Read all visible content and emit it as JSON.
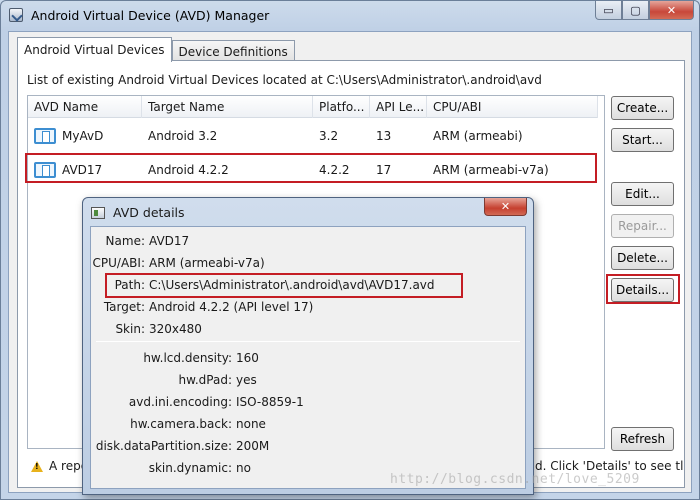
{
  "window": {
    "title": "Android Virtual Device (AVD) Manager",
    "minimize_glyph": "▭",
    "maximize_glyph": "▢",
    "close_glyph": "✕"
  },
  "tabs": [
    {
      "label": "Android Virtual Devices",
      "active": true
    },
    {
      "label": "Device Definitions",
      "active": false
    }
  ],
  "list_label": "List of existing Android Virtual Devices located at C:\\Users\\Administrator\\.android\\avd",
  "table": {
    "columns": [
      "AVD Name",
      "Target Name",
      "Platfo...",
      "API Le...",
      "CPU/ABI"
    ],
    "rows": [
      {
        "avd": "MyAvD",
        "target": "Android 3.2",
        "platform": "3.2",
        "api": "13",
        "cpu": "ARM (armeabi)"
      },
      {
        "avd": "AVD17",
        "target": "Android 4.2.2",
        "platform": "4.2.2",
        "api": "17",
        "cpu": "ARM (armeabi-v7a)"
      }
    ]
  },
  "buttons": {
    "create": "Create...",
    "start": "Start...",
    "edit": "Edit...",
    "repair": "Repair...",
    "delete": "Delete...",
    "details": "Details...",
    "refresh": "Refresh"
  },
  "footer": {
    "left": "A repo",
    "right": "d. Click 'Details' to see tl"
  },
  "dialog": {
    "title": "AVD details",
    "close_glyph": "✕",
    "basic": [
      {
        "key": "Name:",
        "value": "AVD17"
      },
      {
        "key": "CPU/ABI:",
        "value": "ARM (armeabi-v7a)"
      },
      {
        "key": "Path:",
        "value": "C:\\Users\\Administrator\\.android\\avd\\AVD17.avd"
      },
      {
        "key": "Target:",
        "value": "Android 4.2.2 (API level 17)"
      },
      {
        "key": "Skin:",
        "value": "320x480"
      }
    ],
    "properties": [
      {
        "key": "hw.lcd.density:",
        "value": "160"
      },
      {
        "key": "hw.dPad:",
        "value": "yes"
      },
      {
        "key": "avd.ini.encoding:",
        "value": "ISO-8859-1"
      },
      {
        "key": "hw.camera.back:",
        "value": "none"
      },
      {
        "key": "disk.dataPartition.size:",
        "value": "200M"
      },
      {
        "key": "skin.dynamic:",
        "value": "no"
      }
    ]
  },
  "watermark": "http://blog.csdn.net/love_5209"
}
